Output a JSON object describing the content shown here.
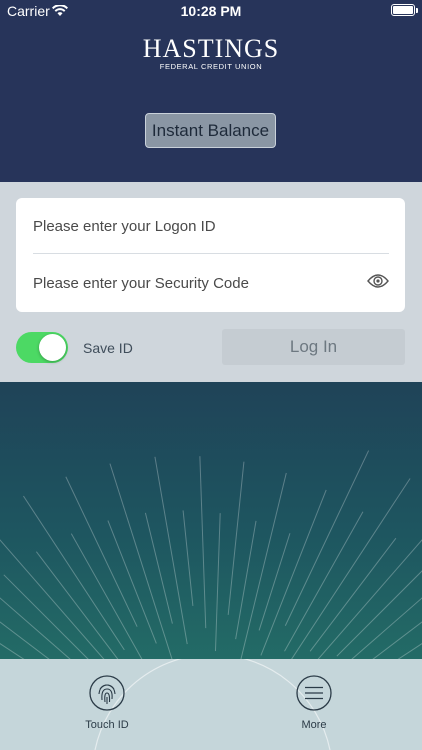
{
  "status_bar": {
    "carrier": "Carrier",
    "time": "10:28 PM"
  },
  "logo": {
    "main": "HASTINGS",
    "sub": "FEDERAL CREDIT UNION"
  },
  "instant_balance": "Instant Balance",
  "login": {
    "logon_placeholder": "Please enter your Logon ID",
    "security_placeholder": "Please enter your Security Code",
    "save_id_label": "Save ID",
    "save_id_on": true,
    "login_button": "Log In"
  },
  "tabs": [
    {
      "label": "Touch ID",
      "icon": "fingerprint-icon"
    },
    {
      "label": "More",
      "icon": "menu-icon"
    }
  ],
  "colors": {
    "header_bg": "#27345a",
    "toggle_on": "#4cd964",
    "bottom_bar": "#c5d6da"
  }
}
